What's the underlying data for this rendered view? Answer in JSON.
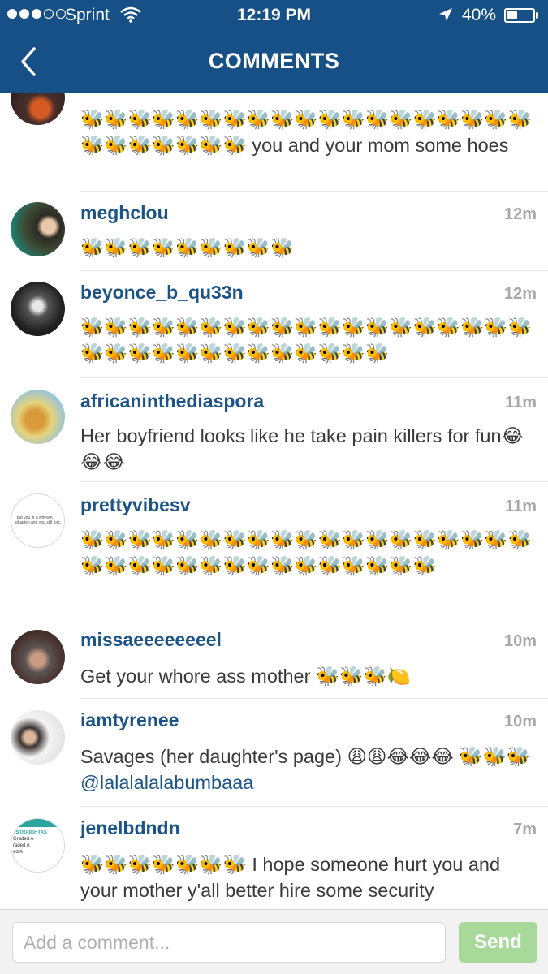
{
  "status_bar": {
    "carrier": "Sprint",
    "time": "12:19 PM",
    "battery_percent_label": "40%",
    "battery_level": 0.4,
    "signal_bars_filled": 3,
    "signal_bars_total": 5
  },
  "nav": {
    "title": "COMMENTS",
    "back_icon": "chevron-left-icon"
  },
  "colors": {
    "header": "#175086",
    "username": "#1c5487",
    "send_button": "#a8d99b"
  },
  "comments": [
    {
      "username": "",
      "time": "",
      "text": "🐝🐝🐝🐝🐝🐝🐝🐝🐝🐝🐝🐝🐝🐝🐝🐝🐝🐝🐝🐝🐝🐝🐝🐝🐝🐝 you and your mom some hoes"
    },
    {
      "username": "meghclou",
      "time": "12m",
      "text": "🐝🐝🐝🐝🐝🐝🐝🐝🐝"
    },
    {
      "username": "beyonce_b_qu33n",
      "time": "12m",
      "text": "🐝🐝🐝🐝🐝🐝🐝🐝🐝🐝🐝🐝🐝🐝🐝🐝🐝🐝🐝🐝🐝🐝🐝🐝🐝🐝🐝🐝🐝🐝🐝🐝"
    },
    {
      "username": "africaninthediaspora",
      "time": "11m",
      "text": "Her boyfriend looks like he take pain killers for fun😂😂😂"
    },
    {
      "username": "prettyvibesv",
      "time": "11m",
      "avatar_caption": "I put you in a win-win situation and you still lost.",
      "text": "🐝🐝🐝🐝🐝🐝🐝🐝🐝🐝🐝🐝🐝🐝🐝🐝🐝🐝🐝🐝🐝🐝🐝🐝🐝🐝🐝🐝🐝🐝🐝🐝🐝🐝"
    },
    {
      "username": "missaeeeeeeeel",
      "time": "10m",
      "text": "Get your whore ass mother 🐝🐝🐝🍋"
    },
    {
      "username": "iamtyrenee",
      "time": "10m",
      "text": "Savages (her daughter's page) 😩😩😂😂😂 🐝🐝🐝",
      "mention": "@lalalalalabumbaaa"
    },
    {
      "username": "jenelbdndn",
      "time": "7m",
      "avatar_lines": [
        "#STRAIGHTAS",
        "Graded  A",
        "raded  A",
        "ed  A"
      ],
      "text": "🐝🐝🐝🐝🐝🐝🐝 I hope someone hurt you and your mother y'all better hire some security"
    }
  ],
  "composer": {
    "placeholder": "Add a comment...",
    "value": "",
    "send_label": "Send"
  }
}
